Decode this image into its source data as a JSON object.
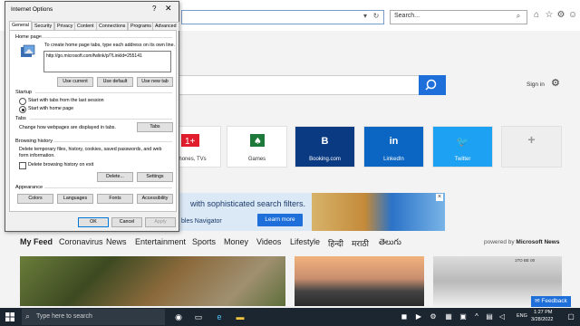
{
  "browser": {
    "address_value": "",
    "search_placeholder": "Search...",
    "refresh_icon": "refresh-icon",
    "home_icon": "home-icon",
    "star_icon": "star-icon",
    "gear_icon": "gear-icon",
    "smiley_icon": "smiley-icon"
  },
  "page": {
    "signin": "Sign in",
    "tiles": [
      {
        "label": "Phones, TVs",
        "color": "#ffffff"
      },
      {
        "label": "Games",
        "color": "#ffffff"
      },
      {
        "glyph": "B",
        "label": "Booking.com",
        "color": "#0a3a82"
      },
      {
        "glyph": "in",
        "label": "LinkedIn",
        "color": "#0a66c2"
      },
      {
        "glyph": "🐦",
        "label": "Twitter",
        "color": "#1da1f2"
      },
      {
        "glyph": "+",
        "label": "",
        "color": "#eeeeee"
      }
    ],
    "ad_text": "with sophisticated search filters.",
    "ad_sub": "bles Navigator",
    "ad_button": "Learn more",
    "nav": [
      "My Feed",
      "Coronavirus",
      "News",
      "Entertainment",
      "Sports",
      "Money",
      "Videos",
      "Lifestyle",
      "हिन्दी",
      "मराठी",
      "తెలుగు"
    ],
    "powered_prefix": "powered by",
    "powered_brand": "Microsoft News",
    "feedback": "Feedback",
    "img3_caption": "1TO BE 00"
  },
  "dialog": {
    "title": "Internet Options",
    "help": "?",
    "close": "✕",
    "tabs": [
      "General",
      "Security",
      "Privacy",
      "Content",
      "Connections",
      "Programs",
      "Advanced"
    ],
    "home_page_heading": "Home page",
    "home_page_desc": "To create home page tabs, type each address on its own line.",
    "home_page_url": "http://go.microsoft.com/fwlink/p/?LinkId=255141",
    "btn_use_current": "Use current",
    "btn_use_default": "Use default",
    "btn_use_new_tab": "Use new tab",
    "startup_heading": "Startup",
    "startup_opt1": "Start with tabs from the last session",
    "startup_opt2": "Start with home page",
    "tabs_heading": "Tabs",
    "tabs_desc": "Change how webpages are displayed in tabs.",
    "btn_tabs": "Tabs",
    "history_heading": "Browsing history",
    "history_desc1": "Delete temporary files, history, cookies, saved passwords, and web",
    "history_desc2": "form information.",
    "history_check": "Delete browsing history on exit",
    "btn_delete": "Delete...",
    "btn_settings": "Settings",
    "appearance_heading": "Appearance",
    "btn_colors": "Colors",
    "btn_languages": "Languages",
    "btn_fonts": "Fonts",
    "btn_accessibility": "Accessibility",
    "btn_ok": "OK",
    "btn_cancel": "Cancel",
    "btn_apply": "Apply"
  },
  "taskbar": {
    "search_placeholder": "Type here to search",
    "time": "1:27 PM",
    "date": "3/28/2022",
    "lang": "ENG"
  }
}
